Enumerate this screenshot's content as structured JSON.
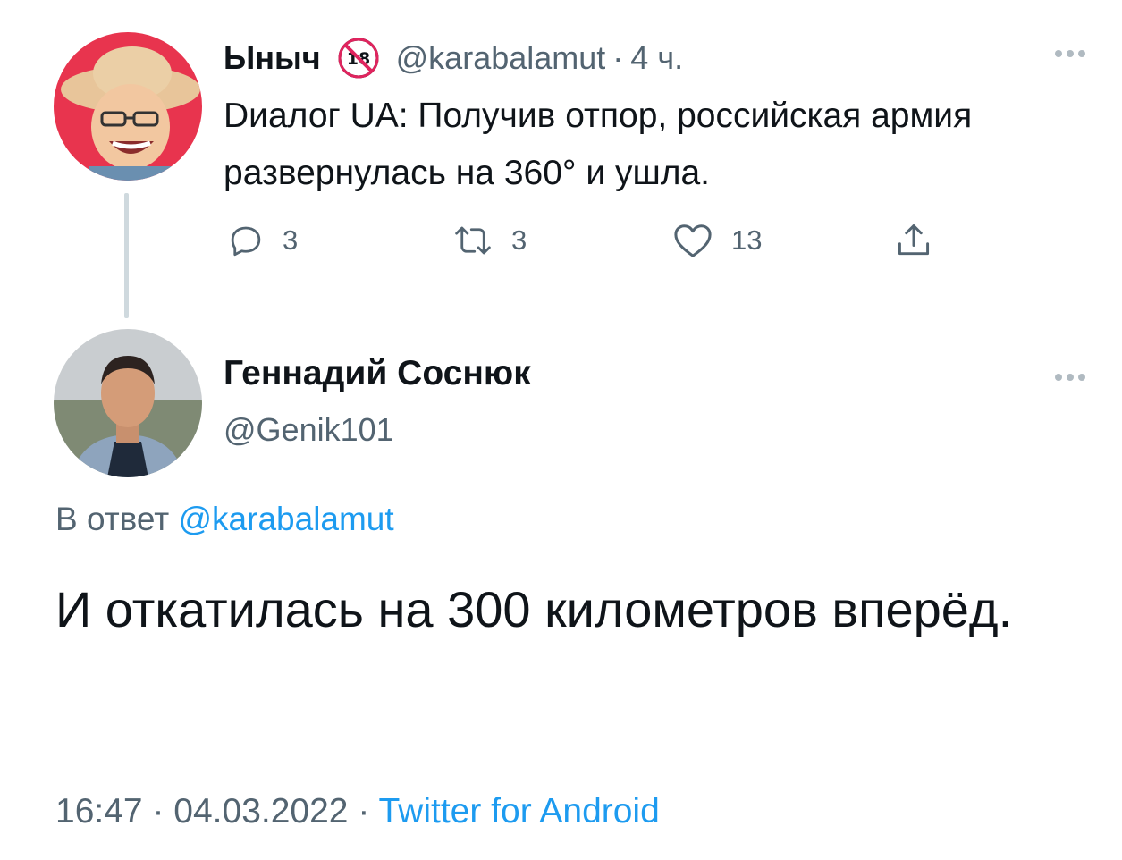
{
  "parent_tweet": {
    "author_name": "Ыныч",
    "badge_label": "18",
    "handle": "@karabalamut",
    "separator": "·",
    "time": "4 ч.",
    "text": "Dиалог UA: Получив отпор, российская армия развернулась на 360° и ушла.",
    "actions": {
      "reply_count": "3",
      "retweet_count": "3",
      "like_count": "13"
    }
  },
  "reply_tweet": {
    "author_name": "Геннадий Соснюк",
    "handle": "@Genik101",
    "reply_to_prefix": "В ответ",
    "reply_to_mention": "@karabalamut",
    "text": "И откатилась на 300 километров вперёд.",
    "time": "16:47",
    "separator": "·",
    "date": "04.03.2022",
    "source": "Twitter for Android"
  },
  "colors": {
    "text_primary": "#0f1419",
    "text_secondary": "#536471",
    "link": "#1d9bf0",
    "thread_line": "#cfd9de"
  },
  "icons": [
    "reply-icon",
    "retweet-icon",
    "like-icon",
    "share-icon",
    "more-icon",
    "adult-18-badge-icon"
  ]
}
